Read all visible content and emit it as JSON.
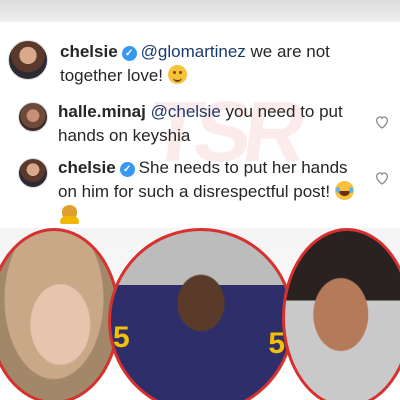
{
  "comments": [
    {
      "username": "chelsie",
      "verified": true,
      "mention": "@glomartinez",
      "text": " we are not together love!",
      "emojis": [
        "smiling-face-emoji"
      ]
    },
    {
      "username": "halle.minaj",
      "verified": false,
      "mention": "@chelsie",
      "text": " you need to put hands on keyshia",
      "emojis": []
    },
    {
      "username": "chelsie",
      "verified": true,
      "mention": "",
      "text": "She needs to put her hands on him for such a disrespectful post!",
      "emojis": [
        "laughing-tears-emoji",
        "facepalm-emoji"
      ]
    }
  ],
  "photos": {
    "middle_jersey_left": "5",
    "middle_jersey_right": "5"
  },
  "colors": {
    "verified": "#3897f0",
    "circle_border": "#d6312f",
    "mention": "#1a3a6b"
  }
}
